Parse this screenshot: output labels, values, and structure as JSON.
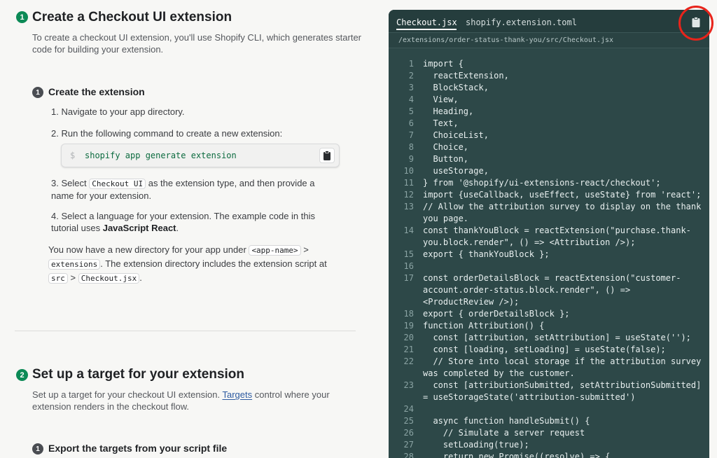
{
  "section1": {
    "number": "1",
    "title": "Create a Checkout UI extension",
    "desc": "To create a checkout UI extension, you'll use Shopify CLI, which generates starter code for building your extension.",
    "step": {
      "number": "1",
      "title": "Create the extension",
      "items": [
        {
          "n": "1.",
          "text": "Navigate to your app directory."
        },
        {
          "n": "2.",
          "text": "Run the following command to create a new extension:"
        },
        {
          "n": "3.",
          "pre": "Select",
          "code": "Checkout UI",
          "post": "as the extension type, and then provide a name for your extension."
        },
        {
          "n": "4.",
          "pre": "Select a language for your extension. The example code in this tutorial uses",
          "bold": "JavaScript React",
          "post": "."
        }
      ],
      "command": {
        "prompt": "$",
        "text": "shopify app generate extension"
      },
      "result": {
        "t1": "You now have a new directory for your app under",
        "c1": "<app-name>",
        "gt": ">",
        "c2": "extensions",
        "t2": ". The extension directory includes the extension script at",
        "c3": "src",
        "c4": "Checkout.jsx",
        "t3": "."
      }
    }
  },
  "section2": {
    "number": "2",
    "title": "Set up a target for your extension",
    "desc_pre": "Set up a target for your checkout UI extension.",
    "link": "Targets",
    "desc_post": "control where your extension renders in the checkout flow.",
    "step": {
      "number": "1",
      "title": "Export the targets from your script file"
    }
  },
  "code_panel": {
    "tabs": [
      "Checkout.jsx",
      "shopify.extension.toml"
    ],
    "active_tab": "Checkout.jsx",
    "path": "/extensions/order-status-thank-you/src/Checkout.jsx",
    "copy_icon": "clipboard-icon",
    "highlight_color": "#e8241b",
    "lines": [
      {
        "n": "1",
        "rows": [
          "import {"
        ]
      },
      {
        "n": "2",
        "rows": [
          "  reactExtension,"
        ]
      },
      {
        "n": "3",
        "rows": [
          "  BlockStack,"
        ]
      },
      {
        "n": "4",
        "rows": [
          "  View,"
        ]
      },
      {
        "n": "5",
        "rows": [
          "  Heading,"
        ]
      },
      {
        "n": "6",
        "rows": [
          "  Text,"
        ]
      },
      {
        "n": "7",
        "rows": [
          "  ChoiceList,"
        ]
      },
      {
        "n": "8",
        "rows": [
          "  Choice,"
        ]
      },
      {
        "n": "9",
        "rows": [
          "  Button,"
        ]
      },
      {
        "n": "10",
        "rows": [
          "  useStorage,"
        ]
      },
      {
        "n": "11",
        "rows": [
          "} from '@shopify/ui-extensions-react/checkout';"
        ]
      },
      {
        "n": "12",
        "rows": [
          "import {useCallback, useEffect, useState} from 'react';"
        ]
      },
      {
        "n": "13",
        "rows": [
          "// Allow the attribution survey to display on the thank",
          "you page."
        ]
      },
      {
        "n": "14",
        "rows": [
          "const thankYouBlock = reactExtension(\"purchase.thank-",
          "you.block.render\", () => <Attribution />);"
        ]
      },
      {
        "n": "15",
        "rows": [
          "export { thankYouBlock };"
        ]
      },
      {
        "n": "16",
        "rows": [
          ""
        ]
      },
      {
        "n": "17",
        "rows": [
          "const orderDetailsBlock = reactExtension(\"customer-",
          "account.order-status.block.render\", () =>",
          "<ProductReview />);"
        ]
      },
      {
        "n": "18",
        "rows": [
          "export { orderDetailsBlock };"
        ]
      },
      {
        "n": "19",
        "rows": [
          "function Attribution() {"
        ]
      },
      {
        "n": "20",
        "rows": [
          "  const [attribution, setAttribution] = useState('');"
        ]
      },
      {
        "n": "21",
        "rows": [
          "  const [loading, setLoading] = useState(false);"
        ]
      },
      {
        "n": "22",
        "rows": [
          "  // Store into local storage if the attribution survey",
          "was completed by the customer."
        ]
      },
      {
        "n": "23",
        "rows": [
          "  const [attributionSubmitted, setAttributionSubmitted]",
          "= useStorageState('attribution-submitted')"
        ]
      },
      {
        "n": "24",
        "rows": [
          ""
        ]
      },
      {
        "n": "25",
        "rows": [
          "  async function handleSubmit() {"
        ]
      },
      {
        "n": "26",
        "rows": [
          "    // Simulate a server request"
        ]
      },
      {
        "n": "27",
        "rows": [
          "    setLoading(true);"
        ]
      },
      {
        "n": "28",
        "rows": [
          "    return new Promise((resolve) => {"
        ]
      }
    ]
  }
}
